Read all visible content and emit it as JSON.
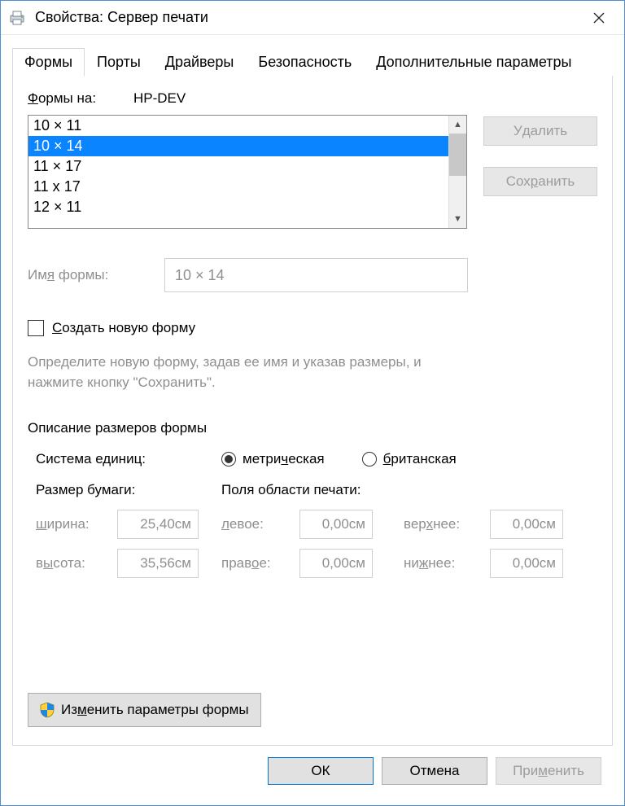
{
  "window": {
    "title": "Свойства: Сервер печати"
  },
  "tabs": {
    "forms": "Формы",
    "ports": "Порты",
    "drivers": "Драйверы",
    "security": "Безопасность",
    "advanced": "Дополнительные параметры"
  },
  "forms_on_label_pre": "Ф",
  "forms_on_label_post": "ормы на:",
  "server_name": "HP-DEV",
  "list": {
    "items": [
      "10 × 11",
      "10 × 14",
      "11 × 17",
      "11 x 17",
      "12 × 11"
    ],
    "selected_index": 1
  },
  "buttons": {
    "delete_pre": "У",
    "delete_post": "далить",
    "save_pre": "Сох",
    "save_mid": "р",
    "save_post": "анить",
    "change_pre": "Из",
    "change_mid": "м",
    "change_post": "енить параметры формы",
    "ok": "ОК",
    "cancel": "Отмена",
    "apply_pre": "При",
    "apply_mid": "м",
    "apply_post": "енить"
  },
  "form_name": {
    "label_pre": "Им",
    "label_mid": "я",
    "label_post": " формы:",
    "value": "10 × 14"
  },
  "create_checkbox": {
    "label_pre": "С",
    "label_post": "оздать новую форму",
    "checked": false
  },
  "help_text": "Определите новую форму, задав ее имя и указав размеры, и нажмите кнопку \"Сохранить\".",
  "group_title": "Описание размеров формы",
  "units": {
    "label": "Система единиц:",
    "metric_pre": " метри",
    "metric_mid": "ч",
    "metric_post": "еская",
    "british_pre": " ",
    "british_mid": "б",
    "british_post": "ританская",
    "selected": "metric"
  },
  "paper": {
    "header": "Размер бумаги:",
    "width_label_pre": "ш",
    "width_label_post": "ирина:",
    "width_value": "25,40см",
    "height_label_pre": "в",
    "height_label_mid": "ы",
    "height_label_post": "сота:",
    "height_value": "35,56см"
  },
  "margins": {
    "header": "Поля области печати:",
    "left_label_pre": "л",
    "left_label_post": "евое:",
    "left_value": "0,00см",
    "right_label_pre": "прав",
    "right_label_mid": "о",
    "right_label_post": "е:",
    "right_value": "0,00см",
    "top_label_pre": "вер",
    "top_label_mid": "х",
    "top_label_post": "нее:",
    "top_value": "0,00см",
    "bottom_label_pre": "ни",
    "bottom_label_mid": "ж",
    "bottom_label_post": "нее:",
    "bottom_value": "0,00см"
  }
}
